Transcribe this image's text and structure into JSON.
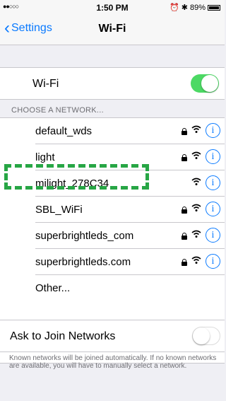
{
  "status_bar": {
    "signal": "●●○○○",
    "time": "1:50 PM",
    "battery_percent": "89%"
  },
  "nav": {
    "back_label": "Settings",
    "title": "Wi-Fi"
  },
  "wifi_toggle": {
    "label": "Wi-Fi",
    "state": "on",
    "color_on": "#4cd964"
  },
  "networks_header": "CHOOSE A NETWORK...",
  "networks": [
    {
      "name": "default_wds",
      "secured": true
    },
    {
      "name": "light",
      "secured": true
    },
    {
      "name": "milight_278C34",
      "secured": false
    },
    {
      "name": "SBL_WiFi",
      "secured": true
    },
    {
      "name": "superbrightleds_com",
      "secured": true
    },
    {
      "name": "superbrightleds.com",
      "secured": true
    },
    {
      "name": "Other...",
      "secured": false
    }
  ],
  "ask_to_join": {
    "label": "Ask to Join Networks",
    "state": "off",
    "note": "Known networks will be joined automatically. If no known networks are available, you will have to manually select a network."
  },
  "colors": {
    "accent": "#0a7aff",
    "highlight": "#27a645"
  }
}
